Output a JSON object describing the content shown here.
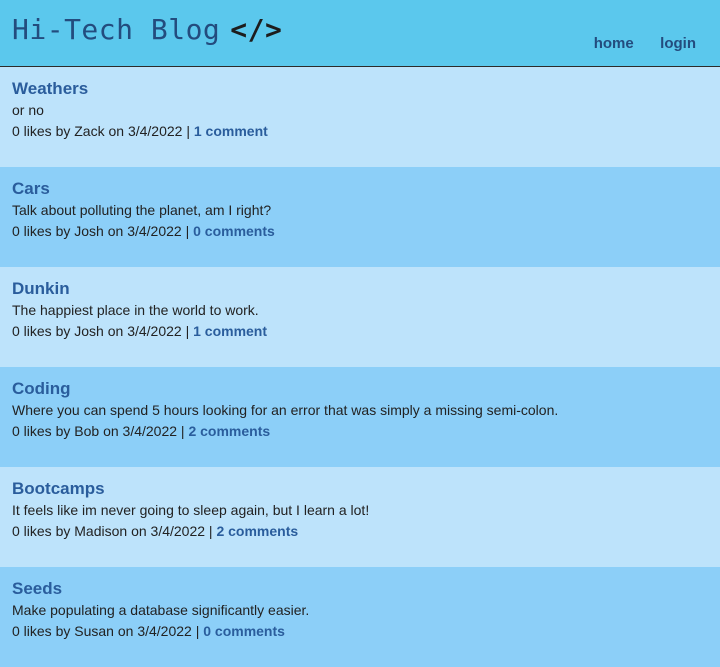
{
  "header": {
    "title": "Hi-Tech Blog",
    "icon": "</>",
    "nav": {
      "home": "home",
      "login": "login"
    }
  },
  "posts": [
    {
      "title": "Weathers",
      "body": "or no",
      "likes": "0 likes by",
      "author": "Zack",
      "on": "on",
      "date": "3/4/2022",
      "sep": "|",
      "comments": "1 comment"
    },
    {
      "title": "Cars",
      "body": "Talk about polluting the planet, am I right?",
      "likes": "0 likes by",
      "author": "Josh",
      "on": "on",
      "date": "3/4/2022",
      "sep": "|",
      "comments": "0 comments"
    },
    {
      "title": "Dunkin",
      "body": "The happiest place in the world to work.",
      "likes": "0 likes by",
      "author": "Josh",
      "on": "on",
      "date": "3/4/2022",
      "sep": "|",
      "comments": "1 comment"
    },
    {
      "title": "Coding",
      "body": "Where you can spend 5 hours looking for an error that was simply a missing semi-colon.",
      "likes": "0 likes by",
      "author": "Bob",
      "on": "on",
      "date": "3/4/2022",
      "sep": "|",
      "comments": "2 comments"
    },
    {
      "title": "Bootcamps",
      "body": "It feels like im never going to sleep again, but I learn a lot!",
      "likes": "0 likes by",
      "author": "Madison",
      "on": "on",
      "date": "3/4/2022",
      "sep": "|",
      "comments": "2 comments"
    },
    {
      "title": "Seeds",
      "body": "Make populating a database significantly easier.",
      "likes": "0 likes by",
      "author": "Susan",
      "on": "on",
      "date": "3/4/2022",
      "sep": "|",
      "comments": "0 comments"
    }
  ],
  "colors": {
    "header_bg": "#5bc8ed",
    "post_light": "#bde3fb",
    "post_dark": "#8ccff8",
    "accent": "#2a5d9c"
  }
}
